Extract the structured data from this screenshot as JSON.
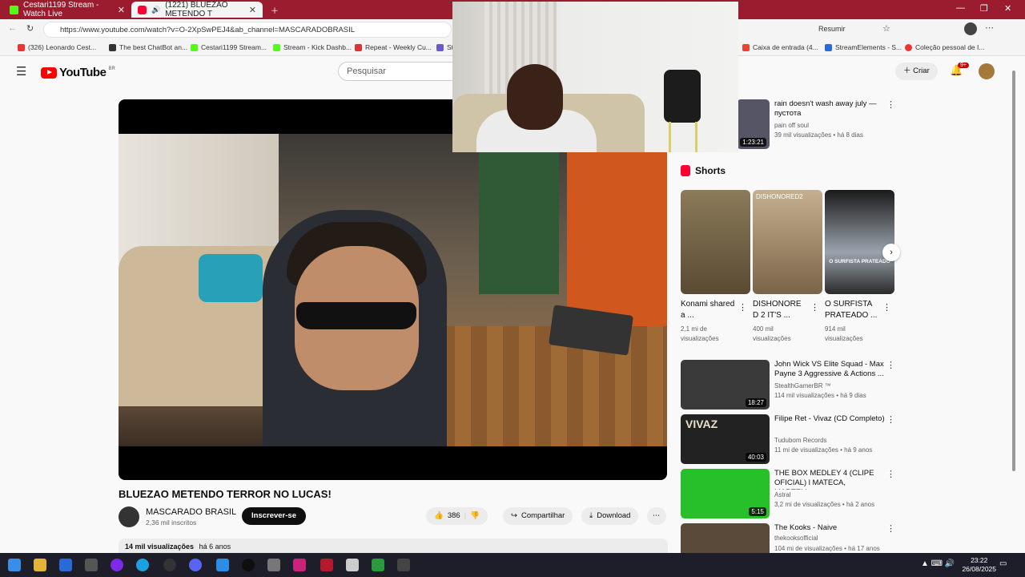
{
  "browser": {
    "tabs": [
      {
        "title": "Cestari1199 Stream - Watch Live"
      },
      {
        "title": "(1221) BLUEZAO METENDO T"
      }
    ],
    "url": "https://www.youtube.com/watch?v=O-2XpSwPEJ4&ab_channel=MASCARADOBRASIL",
    "summarize_label": "Resumir",
    "bookmarks": [
      "(326) Leonardo Cest...",
      "The best ChatBot an...",
      "Cestari1199 Stream...",
      "Stream - Kick Dashb...",
      "Repeat - Weekly Cu...",
      "St",
      "Caixa de entrada (4...",
      "StreamElements - S...",
      "Coleção pessoal de I..."
    ]
  },
  "youtube": {
    "logo_text": "YouTube",
    "logo_region": "BR",
    "search_placeholder": "Pesquisar",
    "create_label": "Criar",
    "notif_badge": "9+",
    "video": {
      "title": "BLUEZAO METENDO TERROR NO LUCAS!",
      "channel": "MASCARADO BRASIL",
      "subscribers": "2,36 mil inscritos",
      "subscribe_label": "Inscrever-se",
      "likes": "386",
      "share_label": "Compartilhar",
      "download_label": "Download",
      "views": "14 mil visualizações",
      "age": "há 6 anos"
    },
    "first_rec": {
      "title": "rain doesn't wash away july — пустота",
      "channel": "pain off soul",
      "meta": "39 mil visualizações • há 8 dias",
      "duration": "1:23:21"
    },
    "shorts_title": "Shorts",
    "shorts": [
      {
        "title": "Konami shared a ...",
        "views": "2,1 mi de visualizações",
        "overlay": ""
      },
      {
        "title": "DISHONORE D 2 IT'S ...",
        "views": "400 mil visualizações",
        "overlay": "DISHONORED2"
      },
      {
        "title": "O SURFISTA PRATEADO ...",
        "views": "914 mil visualizações",
        "overlay": "O SURFISTA PRATEADO"
      }
    ],
    "recommendations": [
      {
        "title": "John Wick VS Elite Squad - Max Payne 3 Aggressive & Actions ...",
        "channel": "StealthGamerBR ™",
        "meta": "114 mil visualizações • há 9 dias",
        "duration": "18:27",
        "color": "#3a3a3a"
      },
      {
        "title": "Filipe Ret - Vivaz (CD Completo)",
        "channel": "Tudubom Records",
        "meta": "11 mi de visualizações • há 9 anos",
        "duration": "40:03",
        "color": "#222222",
        "overlay": "VIVAZ"
      },
      {
        "title": "THE BOX MEDLEY 4 (CLIPE OFICIAL) l MATECA, MARTELL...",
        "channel": "Astral",
        "meta": "3,2 mi de visualizações • há 2 anos",
        "duration": "5:15",
        "color": "#27c02a"
      },
      {
        "title": "The Kooks - Naive",
        "channel": "thekooksofficial",
        "meta": "104 mi de visualizações • há 17 anos",
        "duration": "",
        "color": "#5a4a3a"
      }
    ]
  },
  "taskbar": {
    "time": "23:22",
    "date": "26/08/2025"
  }
}
